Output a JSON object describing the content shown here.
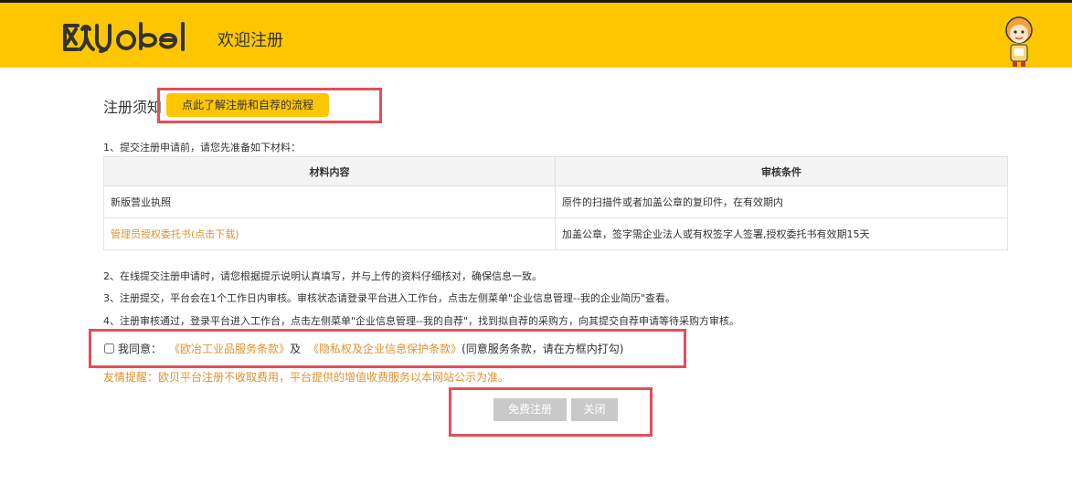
{
  "header": {
    "logo_alt": "欧贝 obei",
    "subtitle": "欢迎注册",
    "bg_color": "#fcc600"
  },
  "notice": {
    "title": "注册须知",
    "flow_button": "点此了解注册和自荐的流程"
  },
  "steps": {
    "s1": "1、提交注册申请前，请您先准备如下材料：",
    "s2": "2、在线提交注册申请时，请您根据提示说明认真填写，并与上传的资料仔细核对，确保信息一致。",
    "s3": "3、注册提交，平台会在1个工作日内审核。审核状态请登录平台进入工作台，点击左侧菜单\"企业信息管理--我的企业简历\"查看。",
    "s4": "4、注册审核通过，登录平台进入工作台，点击左侧菜单\"企业信息管理--我的自荐\"，找到拟自荐的采购方，向其提交自荐申请等待采购方审核。"
  },
  "materials": {
    "headers": [
      "材料内容",
      "审核条件"
    ],
    "rows": [
      {
        "item": "新版营业执照",
        "condition": "原件的扫描件或者加盖公章的复印件，在有效期内"
      },
      {
        "item": "管理员授权委托书(点击下载)",
        "condition": "加盖公章，签字需企业法人或有权签字人签署,授权委托书有效期15天"
      }
    ]
  },
  "agreement": {
    "checked": false,
    "label": "我同意：",
    "link1": "《欧冶工业品服务条款》",
    "and": "及",
    "link2": "《隐私权及企业信息保护条款》",
    "hint": "(同意服务条款，请在方框内打勾)"
  },
  "tip": "友情提醒：欧贝平台注册不收取费用，平台提供的增值收费服务以本网站公示为准。",
  "buttons": {
    "register": "免费注册",
    "close": "关闭"
  },
  "colors": {
    "accent": "#fcc600",
    "link": "#e0922f",
    "highlight": "#e34d5a",
    "disabled": "#c9c9c9"
  }
}
